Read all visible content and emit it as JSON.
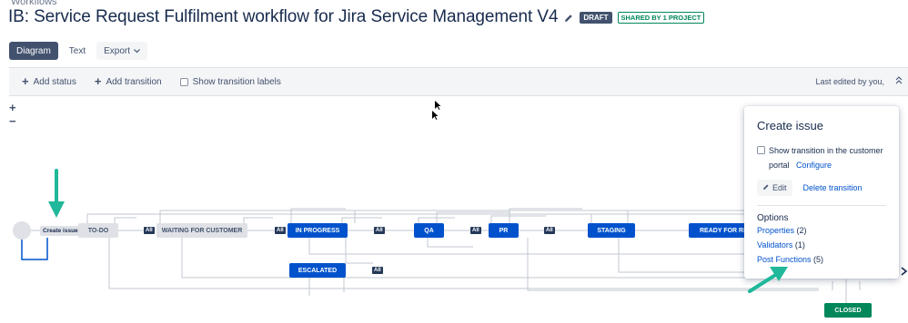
{
  "breadcrumb": "Workflows",
  "header": {
    "title": "IB: Service Request Fulfilment workflow for Jira Service Management V4",
    "draft_label": "DRAFT",
    "shared_label": "SHARED BY 1 PROJECT"
  },
  "tabs": {
    "diagram": "Diagram",
    "text": "Text",
    "export": "Export"
  },
  "toolbar": {
    "add_status": "Add status",
    "add_transition": "Add transition",
    "show_labels": "Show transition labels",
    "last_edited": "Last edited by you,"
  },
  "zoom": {
    "in": "+",
    "out": "−"
  },
  "diagram": {
    "create_issue": "Create issue",
    "statuses": {
      "todo": "TO-DO",
      "waiting": "WAITING FOR CUSTOMER",
      "in_progress": "IN PROGRESS",
      "qa": "QA",
      "pr": "PR",
      "staging": "STAGING",
      "ready": "READY FOR REL",
      "escalated": "ESCALATED",
      "closed": "CLOSED"
    },
    "all_label": "All"
  },
  "popup": {
    "title": "Create issue",
    "checkbox_text_1": "Show transition in the customer",
    "checkbox_text_2": "portal",
    "configure": "Configure",
    "edit": "Edit",
    "delete": "Delete transition",
    "options_title": "Options",
    "properties": "Properties",
    "properties_count": "(2)",
    "validators": "Validators",
    "validators_count": "(1)",
    "post_functions": "Post Functions",
    "post_functions_count": "(5)"
  },
  "colors": {
    "status_blue": "#0052cc",
    "status_grey": "#dfe1e6",
    "status_green": "#00875a",
    "annotation_arrow": "#1fb89a"
  }
}
